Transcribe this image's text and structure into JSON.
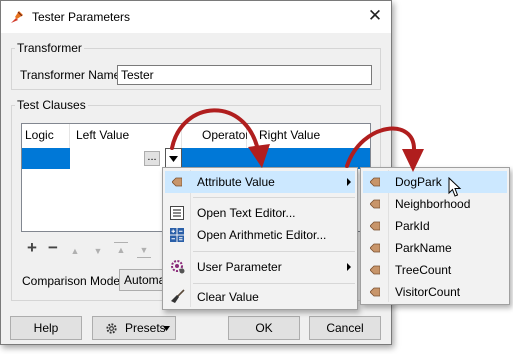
{
  "window": {
    "title": "Tester Parameters",
    "close_glyph": "✕"
  },
  "transformer": {
    "group_label": "Transformer",
    "name_label": "Transformer Name:",
    "name_value": "Tester"
  },
  "test_clauses": {
    "group_label": "Test Clauses",
    "columns": [
      "Logic",
      "Left Value",
      "Operator",
      "Right Value"
    ],
    "ellipsis": "...",
    "toolbar_icons": [
      "add-icon",
      "remove-icon",
      "move-up-icon",
      "move-down-icon",
      "move-top-icon",
      "move-bottom-icon"
    ]
  },
  "comparison": {
    "label": "Comparison Mode:",
    "value": "Automatic"
  },
  "buttons": {
    "help": "Help",
    "presets": "Presets",
    "ok": "OK",
    "cancel": "Cancel"
  },
  "context_menu": {
    "items": [
      {
        "label": "Attribute Value",
        "icon": "attribute-tag-icon",
        "submenu": true,
        "highlighted": true
      },
      {
        "label": "Open Text Editor...",
        "icon": "text-editor-icon"
      },
      {
        "label": "Open Arithmetic Editor...",
        "icon": "arithmetic-editor-icon"
      },
      {
        "label": "User Parameter",
        "icon": "user-parameter-icon",
        "submenu": true
      },
      {
        "label": "Clear Value",
        "icon": "broom-icon"
      }
    ]
  },
  "attribute_submenu": {
    "items": [
      "DogPark",
      "Neighborhood",
      "ParkId",
      "ParkName",
      "TreeCount",
      "VisitorCount"
    ],
    "highlighted": "DogPark"
  },
  "colors": {
    "selection": "#0078d7",
    "menu_highlight": "#cce8ff",
    "annotation_arrow": "#b01e1e",
    "tag": "#c8956a"
  }
}
